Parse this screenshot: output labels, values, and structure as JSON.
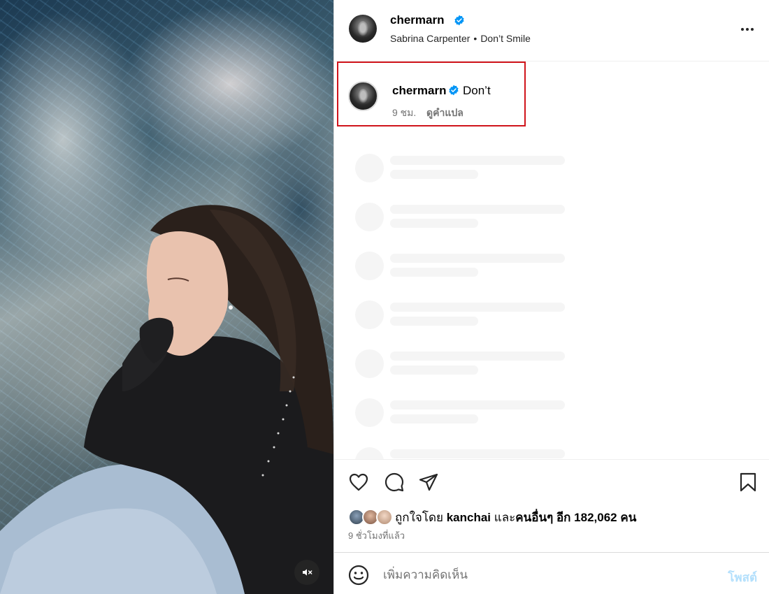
{
  "media": {
    "mute_label": "muted"
  },
  "header": {
    "username": "chermarn",
    "audio_artist": "Sabrina Carpenter",
    "audio_separator": "•",
    "audio_title": "Don’t Smile",
    "verified_color": "#0095f6"
  },
  "caption": {
    "username": "chermarn",
    "text": "Don’t",
    "time": "9 ชม.",
    "translate_label": "ดูคำแปล",
    "highlight_color": "#d0141b"
  },
  "actions": {
    "likes_prefix": "ถูกใจโดย",
    "likes_user": "kanchai",
    "likes_and": "และ",
    "likes_others": "คนอื่นๆ อีก 182,062 คน",
    "timestamp": "9 ชั่วโมงที่แล้ว"
  },
  "comment": {
    "placeholder": "เพิ่มความคิดเห็น",
    "post_label": "โพสต์",
    "post_color": "#b2dffc"
  }
}
